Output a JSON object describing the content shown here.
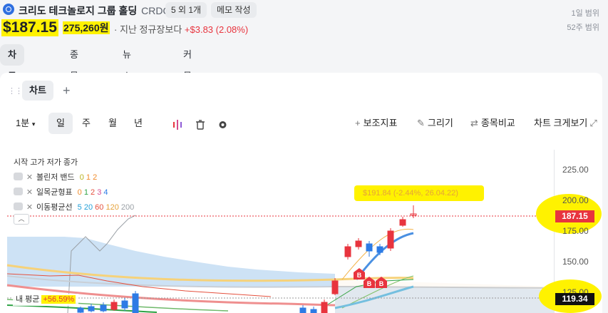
{
  "header": {
    "company": "크리도 테크놀로지 그룹 홀딩",
    "ticker": "CRDO",
    "badge_related": "5 외 1개",
    "badge_memo": "메모 작성",
    "range_day": "1일 범위",
    "range_52w": "52주 범위",
    "price": "$187.15",
    "price_krw": "275,260원",
    "change_prefix": "· 지난 정규장보다",
    "change_value": "+$3.83 (2.08%)"
  },
  "tabs": [
    "차트 · 호가",
    "종목정보",
    "뉴스 · 공시",
    "커뮤니티"
  ],
  "chart_panel": {
    "tab_label": "차트",
    "intervals": [
      "1분",
      "일",
      "주",
      "월",
      "년"
    ],
    "selected_interval": "일",
    "tools": [
      "보조지표",
      "그리기",
      "종목비교",
      "차트 크게보기"
    ],
    "legend_header": "시작 고가 저가 종가",
    "legend": [
      {
        "name": "볼린저 밴드",
        "params": [
          "0",
          "1",
          "2"
        ]
      },
      {
        "name": "일목균형표",
        "params": [
          "0",
          "1",
          "2",
          "3",
          "4"
        ]
      },
      {
        "name": "이동평균선",
        "params": [
          "5",
          "20",
          "60",
          "120",
          "200"
        ]
      }
    ],
    "annotation": "$191.84 (-2.44%, 26.04.22)",
    "avg_label": "내 평균",
    "avg_value": "+56.59%",
    "buy_marker": "B",
    "y_axis": {
      "ticks": [
        "225.00",
        "200.00",
        "175.00",
        "150.00",
        "125.00"
      ],
      "current_label": "187.15",
      "avg_price_label": "119.34"
    },
    "colors": {
      "up": "#e8343e",
      "down": "#2d7be5",
      "highlight": "#fff200"
    }
  }
}
